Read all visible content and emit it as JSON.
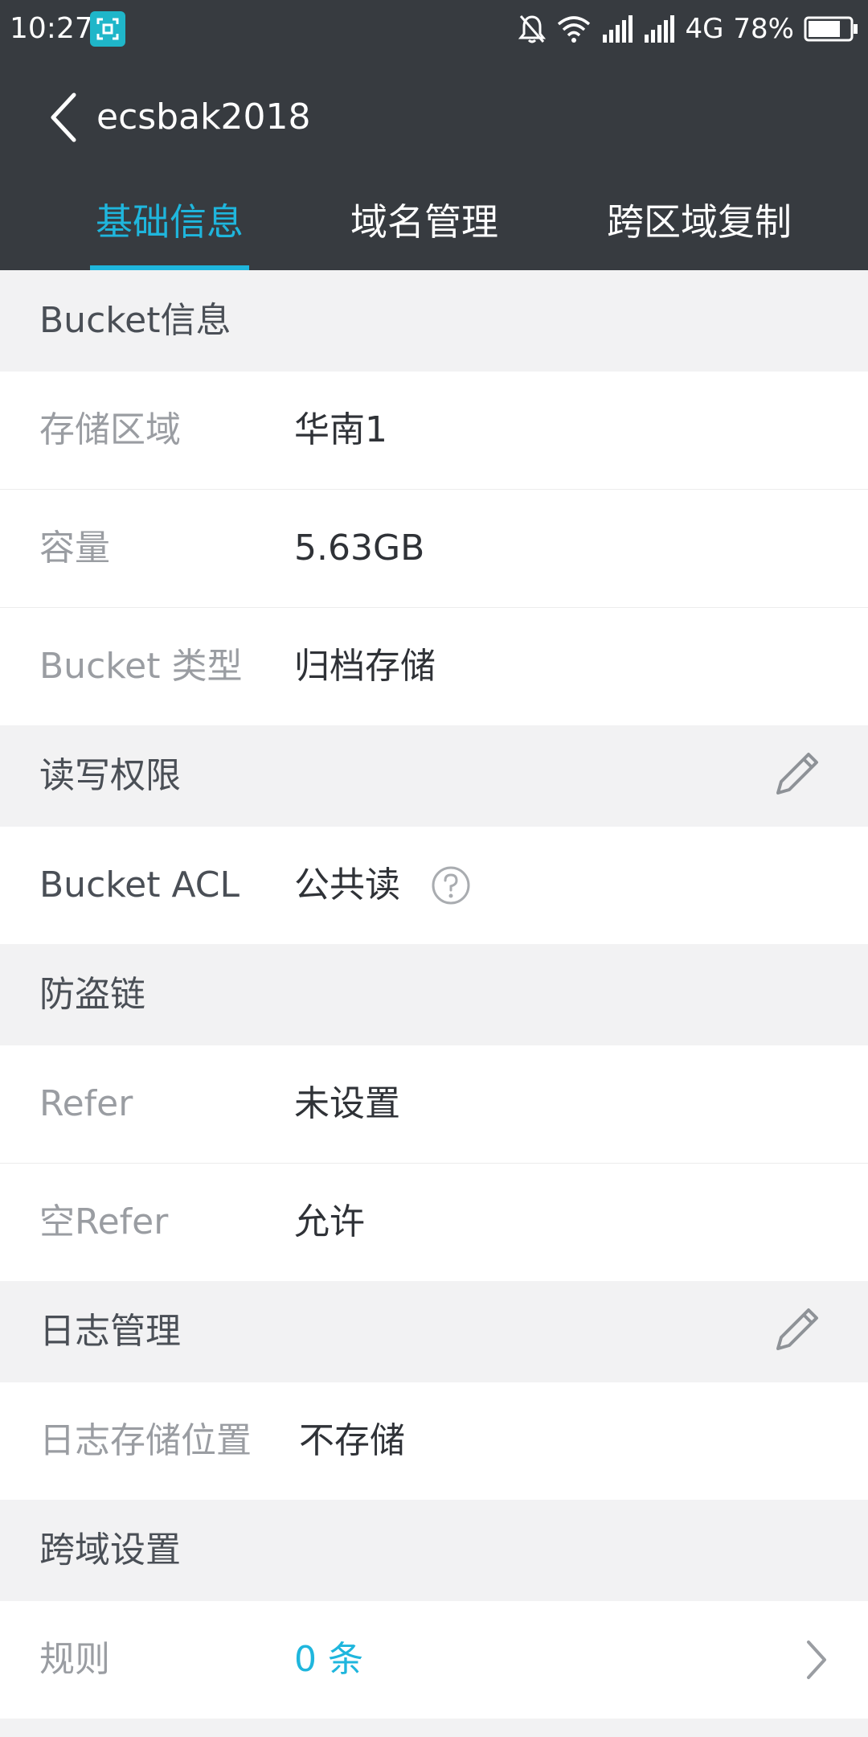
{
  "status_bar": {
    "time": "10:27",
    "network": "4G",
    "battery": "78%"
  },
  "header": {
    "title": "ecsbak2018"
  },
  "tabs": [
    {
      "label": "基础信息",
      "active": true
    },
    {
      "label": "域名管理",
      "active": false
    },
    {
      "label": "跨区域复制",
      "active": false
    }
  ],
  "sections": {
    "bucket_info": {
      "title": "Bucket信息",
      "rows": [
        {
          "label": "存储区域",
          "value": "华南1"
        },
        {
          "label": "容量",
          "value": "5.63GB"
        },
        {
          "label": "Bucket 类型",
          "value": "归档存储"
        }
      ]
    },
    "acl": {
      "title": "读写权限",
      "rows": [
        {
          "label": "Bucket ACL",
          "value": "公共读"
        }
      ]
    },
    "referer": {
      "title": "防盗链",
      "rows": [
        {
          "label": "Refer",
          "value": "未设置"
        },
        {
          "label": "空Refer",
          "value": "允许"
        }
      ]
    },
    "logging": {
      "title": "日志管理",
      "rows": [
        {
          "label": "日志存储位置",
          "value": "不存储"
        }
      ]
    },
    "cors": {
      "title": "跨域设置",
      "rows": [
        {
          "label": "规则",
          "value": "0 条"
        }
      ]
    }
  },
  "icons": {
    "back": "chevron-left-icon",
    "edit": "pencil-icon",
    "help": "question-circle-icon",
    "more": "chevron-right-icon"
  },
  "colors": {
    "header_bg": "#373b40",
    "accent": "#1fb6dd",
    "page_bg": "#f2f2f3"
  }
}
